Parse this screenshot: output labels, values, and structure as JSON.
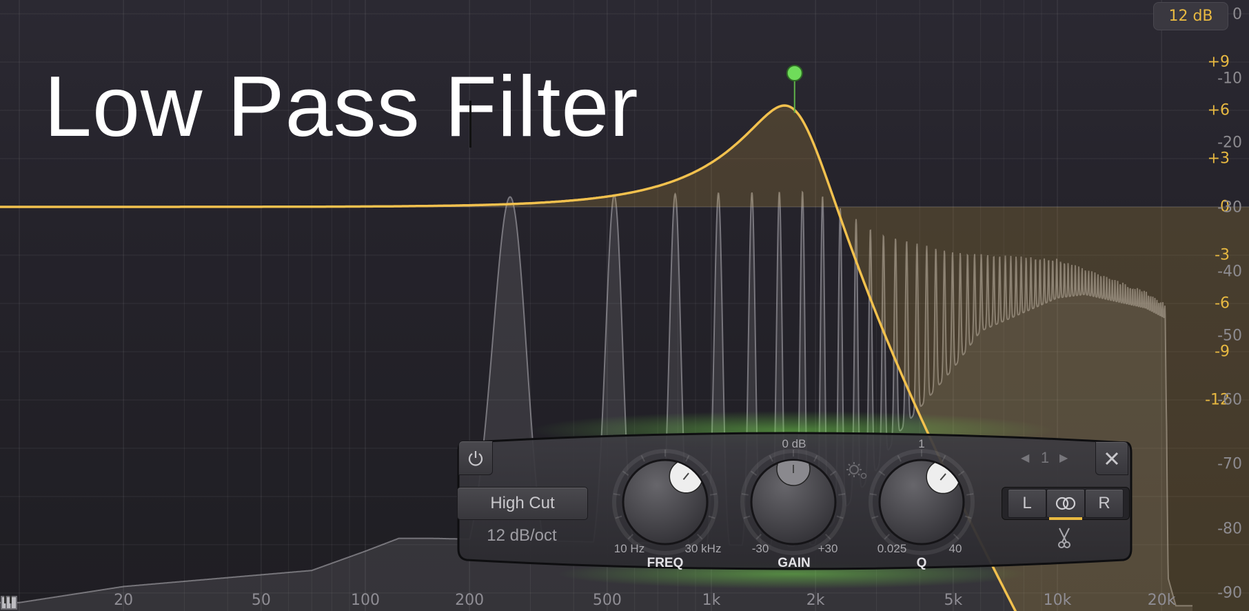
{
  "title": "Low Pass Filter",
  "range_badge": "12 dB",
  "colors": {
    "curve": "#f2c14e",
    "accent": "#e8b941",
    "node": "#6fdc5a",
    "glow": "#5fbf45"
  },
  "axes": {
    "freq_labels": [
      {
        "value": 20,
        "text": "20"
      },
      {
        "value": 50,
        "text": "50"
      },
      {
        "value": 100,
        "text": "100"
      },
      {
        "value": 200,
        "text": "200"
      },
      {
        "value": 500,
        "text": "500"
      },
      {
        "value": 1000,
        "text": "1k"
      },
      {
        "value": 2000,
        "text": "2k"
      },
      {
        "value": 5000,
        "text": "5k"
      },
      {
        "value": 10000,
        "text": "10k"
      },
      {
        "value": 20000,
        "text": "20k"
      }
    ],
    "eq_db_labels": [
      {
        "value": 9,
        "text": "+9"
      },
      {
        "value": 6,
        "text": "+6"
      },
      {
        "value": 3,
        "text": "+3"
      },
      {
        "value": 0,
        "text": "0"
      },
      {
        "value": -3,
        "text": "-3"
      },
      {
        "value": -6,
        "text": "-6"
      },
      {
        "value": -9,
        "text": "-9"
      },
      {
        "value": -12,
        "text": "-12"
      }
    ],
    "spectrum_db_labels": [
      {
        "value": 0,
        "text": "0"
      },
      {
        "value": -10,
        "text": "-10"
      },
      {
        "value": -20,
        "text": "-20"
      },
      {
        "value": -30,
        "text": "-30"
      },
      {
        "value": -40,
        "text": "-40"
      },
      {
        "value": -50,
        "text": "-50"
      },
      {
        "value": -60,
        "text": "-60"
      },
      {
        "value": -70,
        "text": "-70"
      },
      {
        "value": -80,
        "text": "-80"
      },
      {
        "value": -90,
        "text": "-90"
      }
    ]
  },
  "band": {
    "frequency_hz": 1740,
    "q": 2.0,
    "gain_db": 0,
    "shape": "High Cut",
    "slope": "12 dB/oct",
    "index": "1",
    "stereo_mode": "stereo"
  },
  "panel": {
    "freq": {
      "label": "FREQ",
      "min": "10 Hz",
      "max": "30 kHz",
      "knob_fraction": 0.645
    },
    "gain": {
      "label": "GAIN",
      "min": "-30",
      "max": "+30",
      "center": "0 dB",
      "knob_fraction": 0.5
    },
    "q": {
      "label": "Q",
      "min": "0.025",
      "max": "40",
      "center": "1",
      "knob_fraction": 0.65
    },
    "channels": {
      "left": "L",
      "right": "R"
    },
    "icons": [
      "power-icon",
      "gear-icon",
      "prev-arrow-icon",
      "next-arrow-icon",
      "close-icon",
      "stereo-link-icon",
      "scissors-icon",
      "piano-icon"
    ]
  }
}
